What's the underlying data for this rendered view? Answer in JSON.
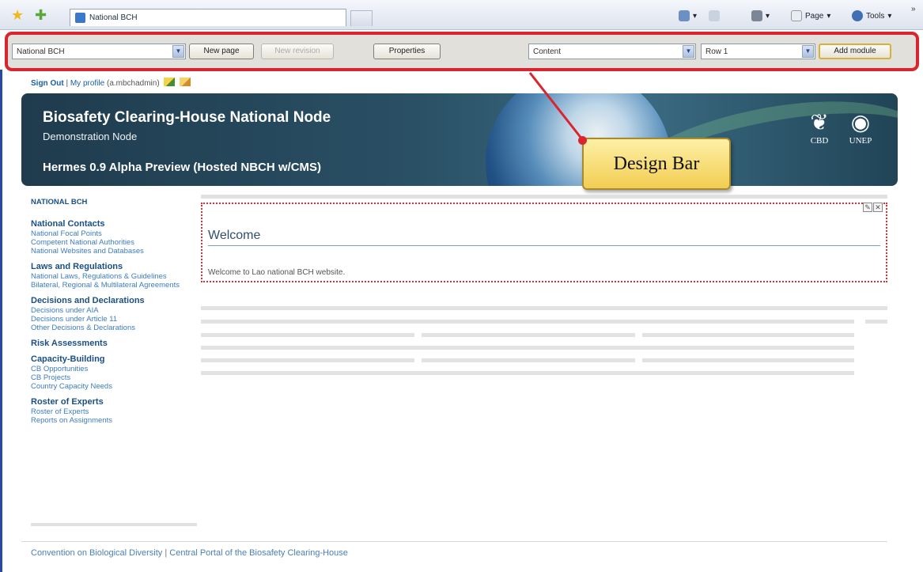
{
  "browser": {
    "tab_title": "National BCH",
    "commands": {
      "page": "Page",
      "tools": "Tools"
    }
  },
  "design_bar": {
    "site_select": "National BCH",
    "new_page": "New page",
    "new_revision": "New revision",
    "properties": "Properties",
    "zone_select": "Content",
    "row_select": "Row 1",
    "add_module": "Add module"
  },
  "user_bar": {
    "sign_out": "Sign Out",
    "separator": "|",
    "my_profile": "My profile",
    "username": "(a.mbchadmin)"
  },
  "banner": {
    "title": "Biosafety Clearing-House National Node",
    "subtitle": "Demonstration Node",
    "version": "Hermes 0.9 Alpha Preview (Hosted NBCH w/CMS)",
    "logo_left": "CBD",
    "logo_right": "UNEP"
  },
  "callout": {
    "label": "Design Bar"
  },
  "nav": {
    "root": "NATIONAL BCH",
    "groups": [
      {
        "heading": "National Contacts",
        "items": [
          "National Focal Points",
          "Competent National Authorities",
          "National Websites and Databases"
        ]
      },
      {
        "heading": "Laws and Regulations",
        "items": [
          "National Laws, Regulations & Guidelines",
          "Bilateral, Regional & Multilateral Agreements"
        ]
      },
      {
        "heading": "Decisions and Declarations",
        "items": [
          "Decisions under AIA",
          "Decisions under Article 11",
          "Other Decisions & Declarations"
        ]
      },
      {
        "heading": "Risk Assessments",
        "items": []
      },
      {
        "heading": "Capacity-Building",
        "items": [
          "CB Opportunities",
          "CB Projects",
          "Country Capacity Needs"
        ]
      },
      {
        "heading": "Roster of Experts",
        "items": [
          "Roster of Experts",
          "Reports on Assignments"
        ]
      }
    ]
  },
  "module": {
    "title": "Welcome",
    "body": "Welcome to Lao national BCH website."
  },
  "footer": {
    "link1": "Convention on Biological Diversity",
    "separator": "|",
    "link2": "Central Portal of the Biosafety Clearing-House"
  },
  "colors": {
    "design_bar_border": "#d92530",
    "banner": "#1f3b4d",
    "nav_heading": "#1a4f85",
    "nav_link": "#3d7cc0",
    "callout": "#f2cd52"
  }
}
